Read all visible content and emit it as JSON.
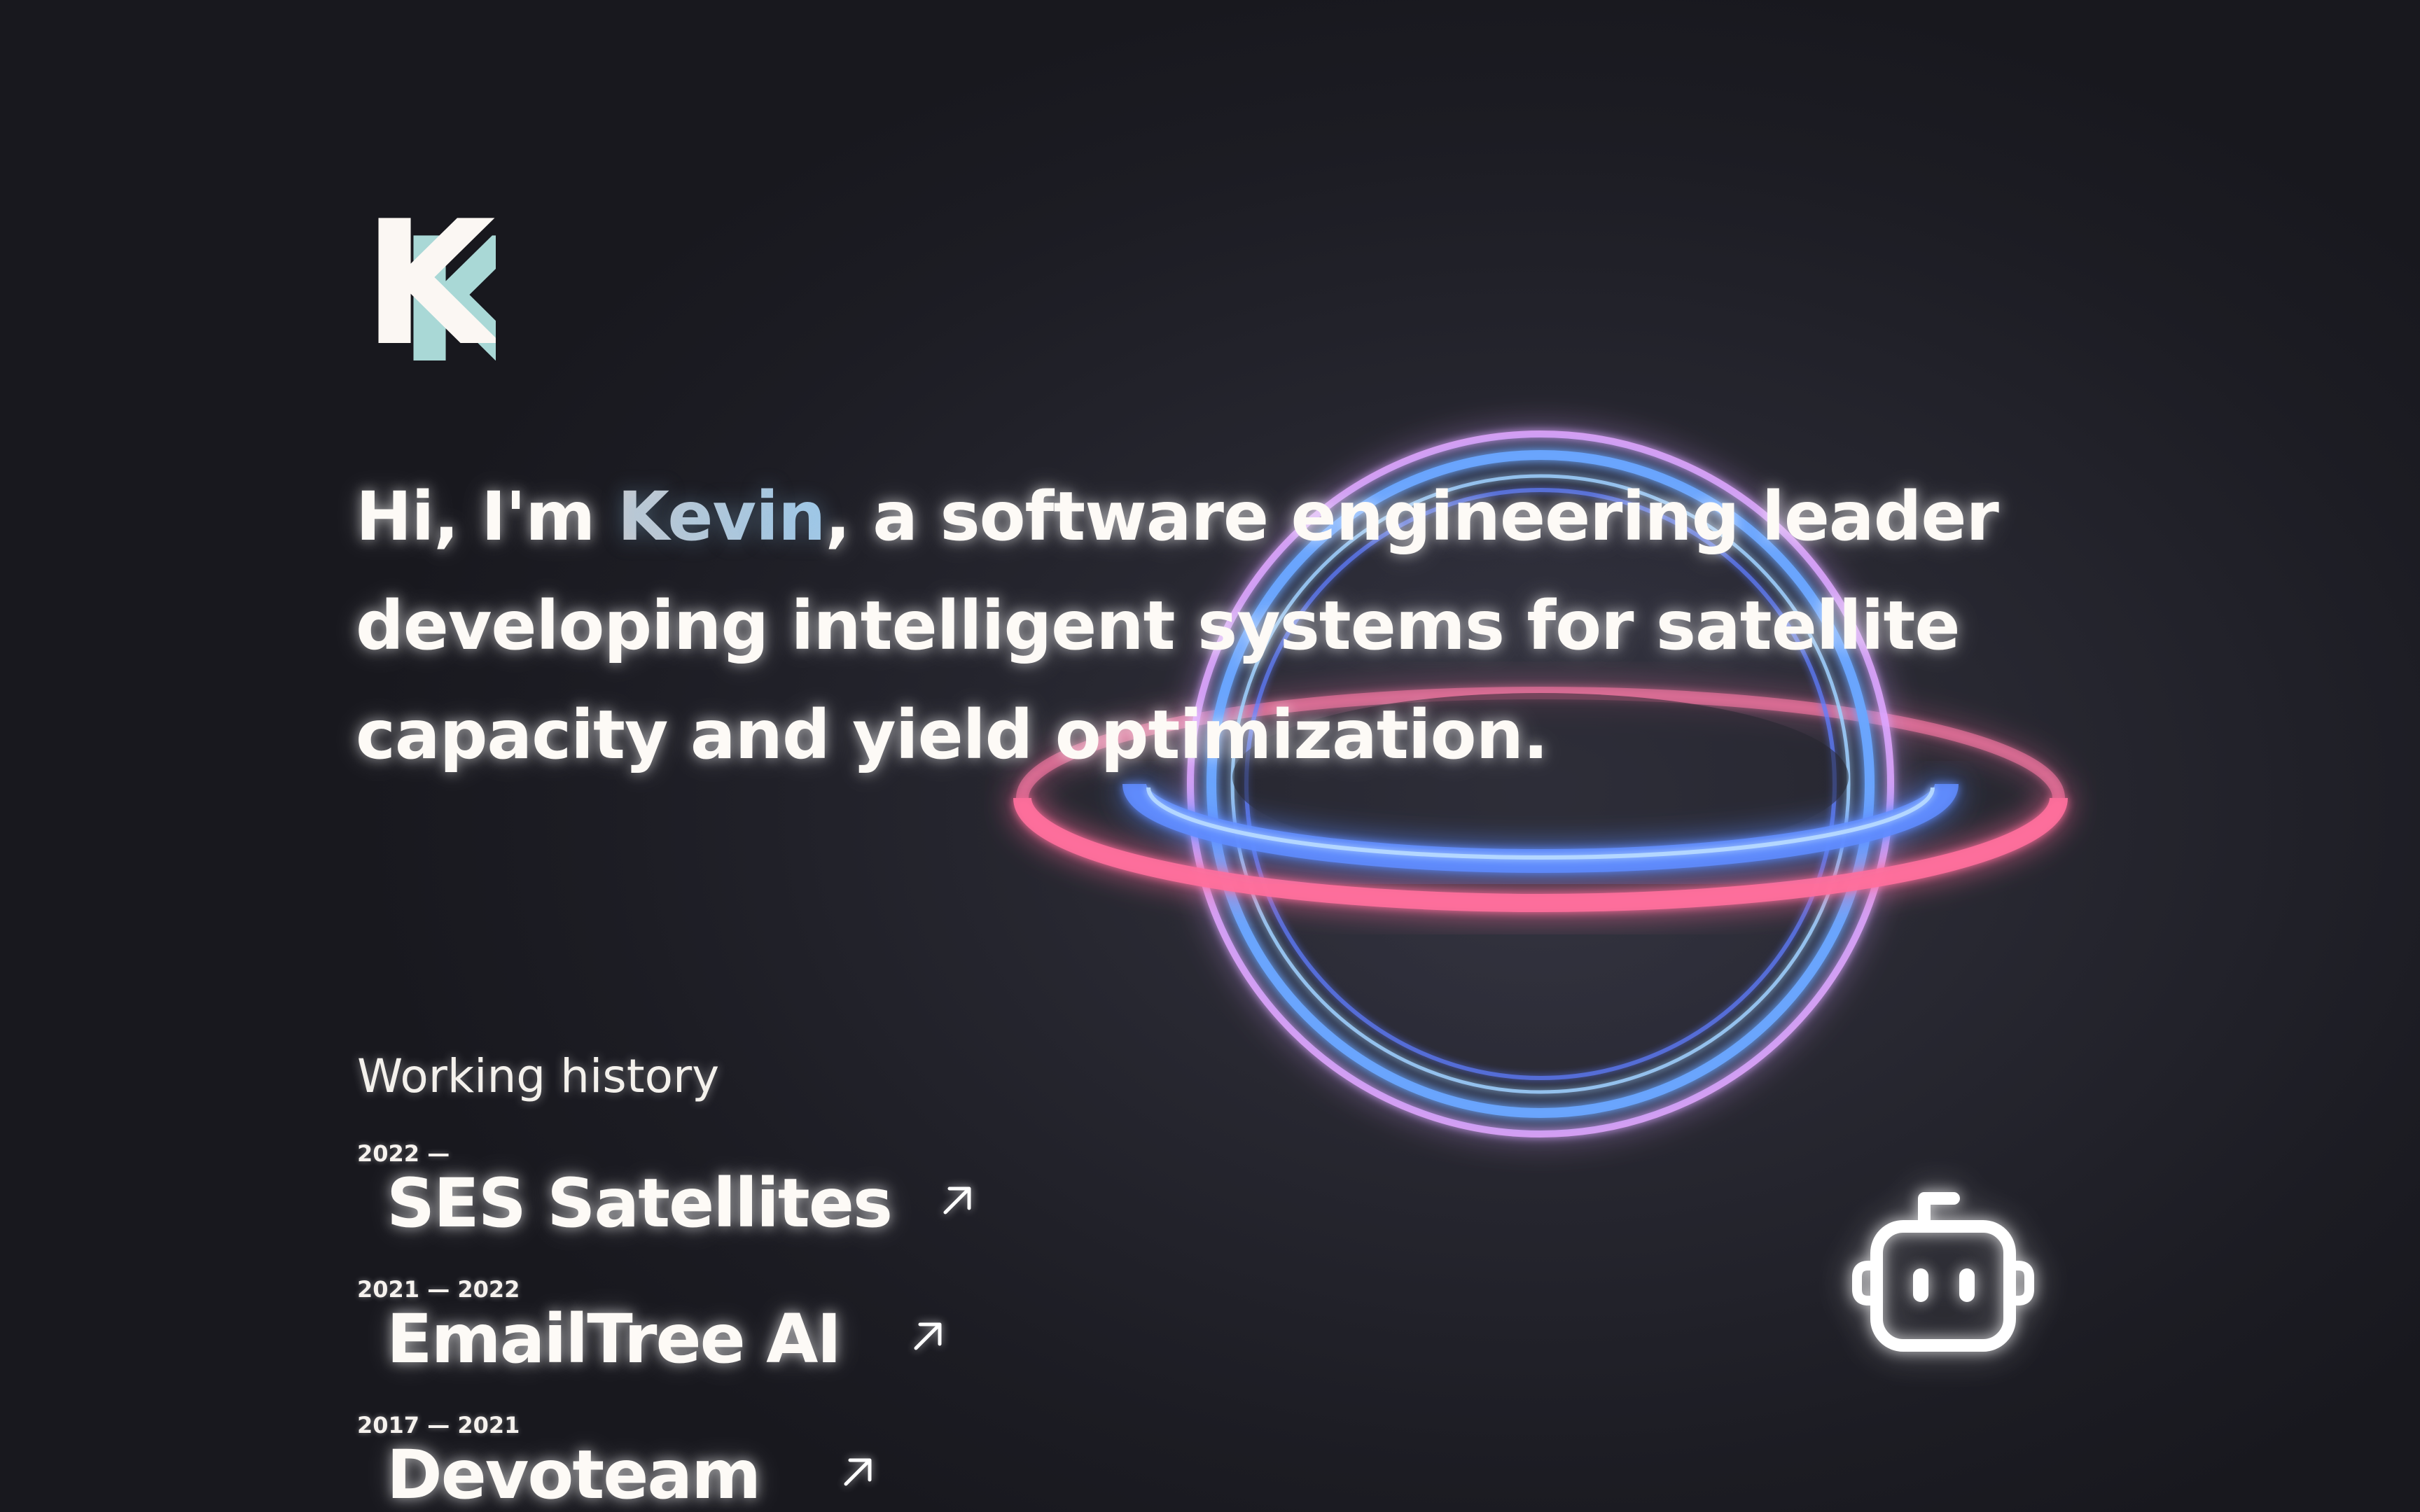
{
  "logo": {
    "letter": "K",
    "colors": {
      "front": "#fbf7f3",
      "shadow": "#a9d8d6"
    }
  },
  "intro": {
    "before": "Hi, I'm ",
    "name": "Kevin",
    "after": ", a software engineering leader developing intelligent systems for satellite capacity and yield optimization."
  },
  "history": {
    "title": "Working history",
    "jobs": [
      {
        "years": "2022 —",
        "company": "SES Satellites",
        "icon": "arrow-up-right-icon"
      },
      {
        "years": "2021 — 2022",
        "company": "EmailTree AI",
        "icon": "arrow-up-right-icon"
      },
      {
        "years": "2017 — 2021",
        "company": "Devoteam",
        "icon": "arrow-up-right-icon"
      }
    ]
  },
  "decor": {
    "planet_icon": "neon-ringed-planet",
    "bot_icon": "robot-chat-icon",
    "colors": {
      "ring_pink": "#ff6fa8",
      "ring_blue": "#5f8cff",
      "glow_violet": "#c89cff"
    }
  }
}
